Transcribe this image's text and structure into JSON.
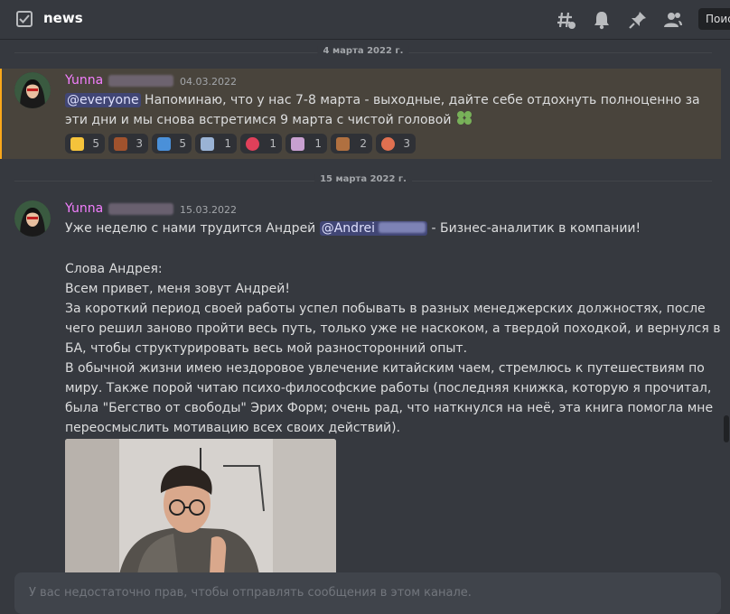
{
  "channel": {
    "name": "news",
    "icon": "announcement-channel-icon"
  },
  "header": {
    "icons": [
      "threads-icon",
      "bell-icon",
      "pin-icon",
      "members-icon"
    ],
    "search_placeholder": "Поиск"
  },
  "dividers": [
    {
      "label": "4 марта 2022 г."
    },
    {
      "label": "15 марта 2022 г."
    }
  ],
  "messages": [
    {
      "author": "Yunna",
      "timestamp": "04.03.2022",
      "mention": "@everyone",
      "line1": " Напоминаю, что у нас 7-8 марта - выходные, дайте себе отдохнуть полноценно за",
      "line2": "эти дни и мы снова встретимся 9 марта с чистой головой",
      "line2_emoji": "four-leaf-clover-icon",
      "reactions": [
        {
          "emoji": "thumbs-up-icon",
          "count": "5",
          "color": "#f5c33b"
        },
        {
          "emoji": "person-emoji-icon",
          "count": "3",
          "color": "#a0522d"
        },
        {
          "emoji": "face-palm-emoji-icon",
          "count": "5",
          "color": "#4a90d9"
        },
        {
          "emoji": "sneaker-emoji-icon",
          "count": "1",
          "color": "#9ab3d5"
        },
        {
          "emoji": "flower-emoji-icon",
          "count": "1",
          "color": "#e0405a"
        },
        {
          "emoji": "painting-emoji-icon",
          "count": "1",
          "color": "#c8a0d0"
        },
        {
          "emoji": "ladder-emoji-icon",
          "count": "2",
          "color": "#b07040"
        },
        {
          "emoji": "eye-emoji-icon",
          "count": "3",
          "color": "#e07050"
        }
      ]
    },
    {
      "author": "Yunna",
      "timestamp": "15.03.2022",
      "intro_before": "Уже неделю с нами трудится Андрей ",
      "mention": "@Andrei",
      "intro_after": " - Бизнес-аналитик в компании!",
      "lines": [
        "Слова Андрея:",
        "Всем привет, меня зовут Андрей!",
        "За короткий период своей работы успел побывать в разных менеджерских должностях, после",
        "чего решил заново пройти весь путь, только уже не наскоком, а твердой походкой, и вернулся в",
        "БА, чтобы структурировать весь мой разносторонний опыт.",
        "В обычной жизни имею нездоровое увлечение китайским чаем, стремлюсь к путешествиям по",
        "миру. Также порой читаю психо-философские работы (последняя книжка, которую я прочитал,",
        "была \"Бегство от свободы\" Эрих Форм; очень рад, что наткнулся на неё, эта книга помогла мне",
        "переосмыслить мотивацию всех своих действий)."
      ],
      "attachment": "photo-attachment"
    }
  ],
  "composer": {
    "placeholder": "У вас недостаточно прав, чтобы отправлять сообщения в этом канале."
  }
}
